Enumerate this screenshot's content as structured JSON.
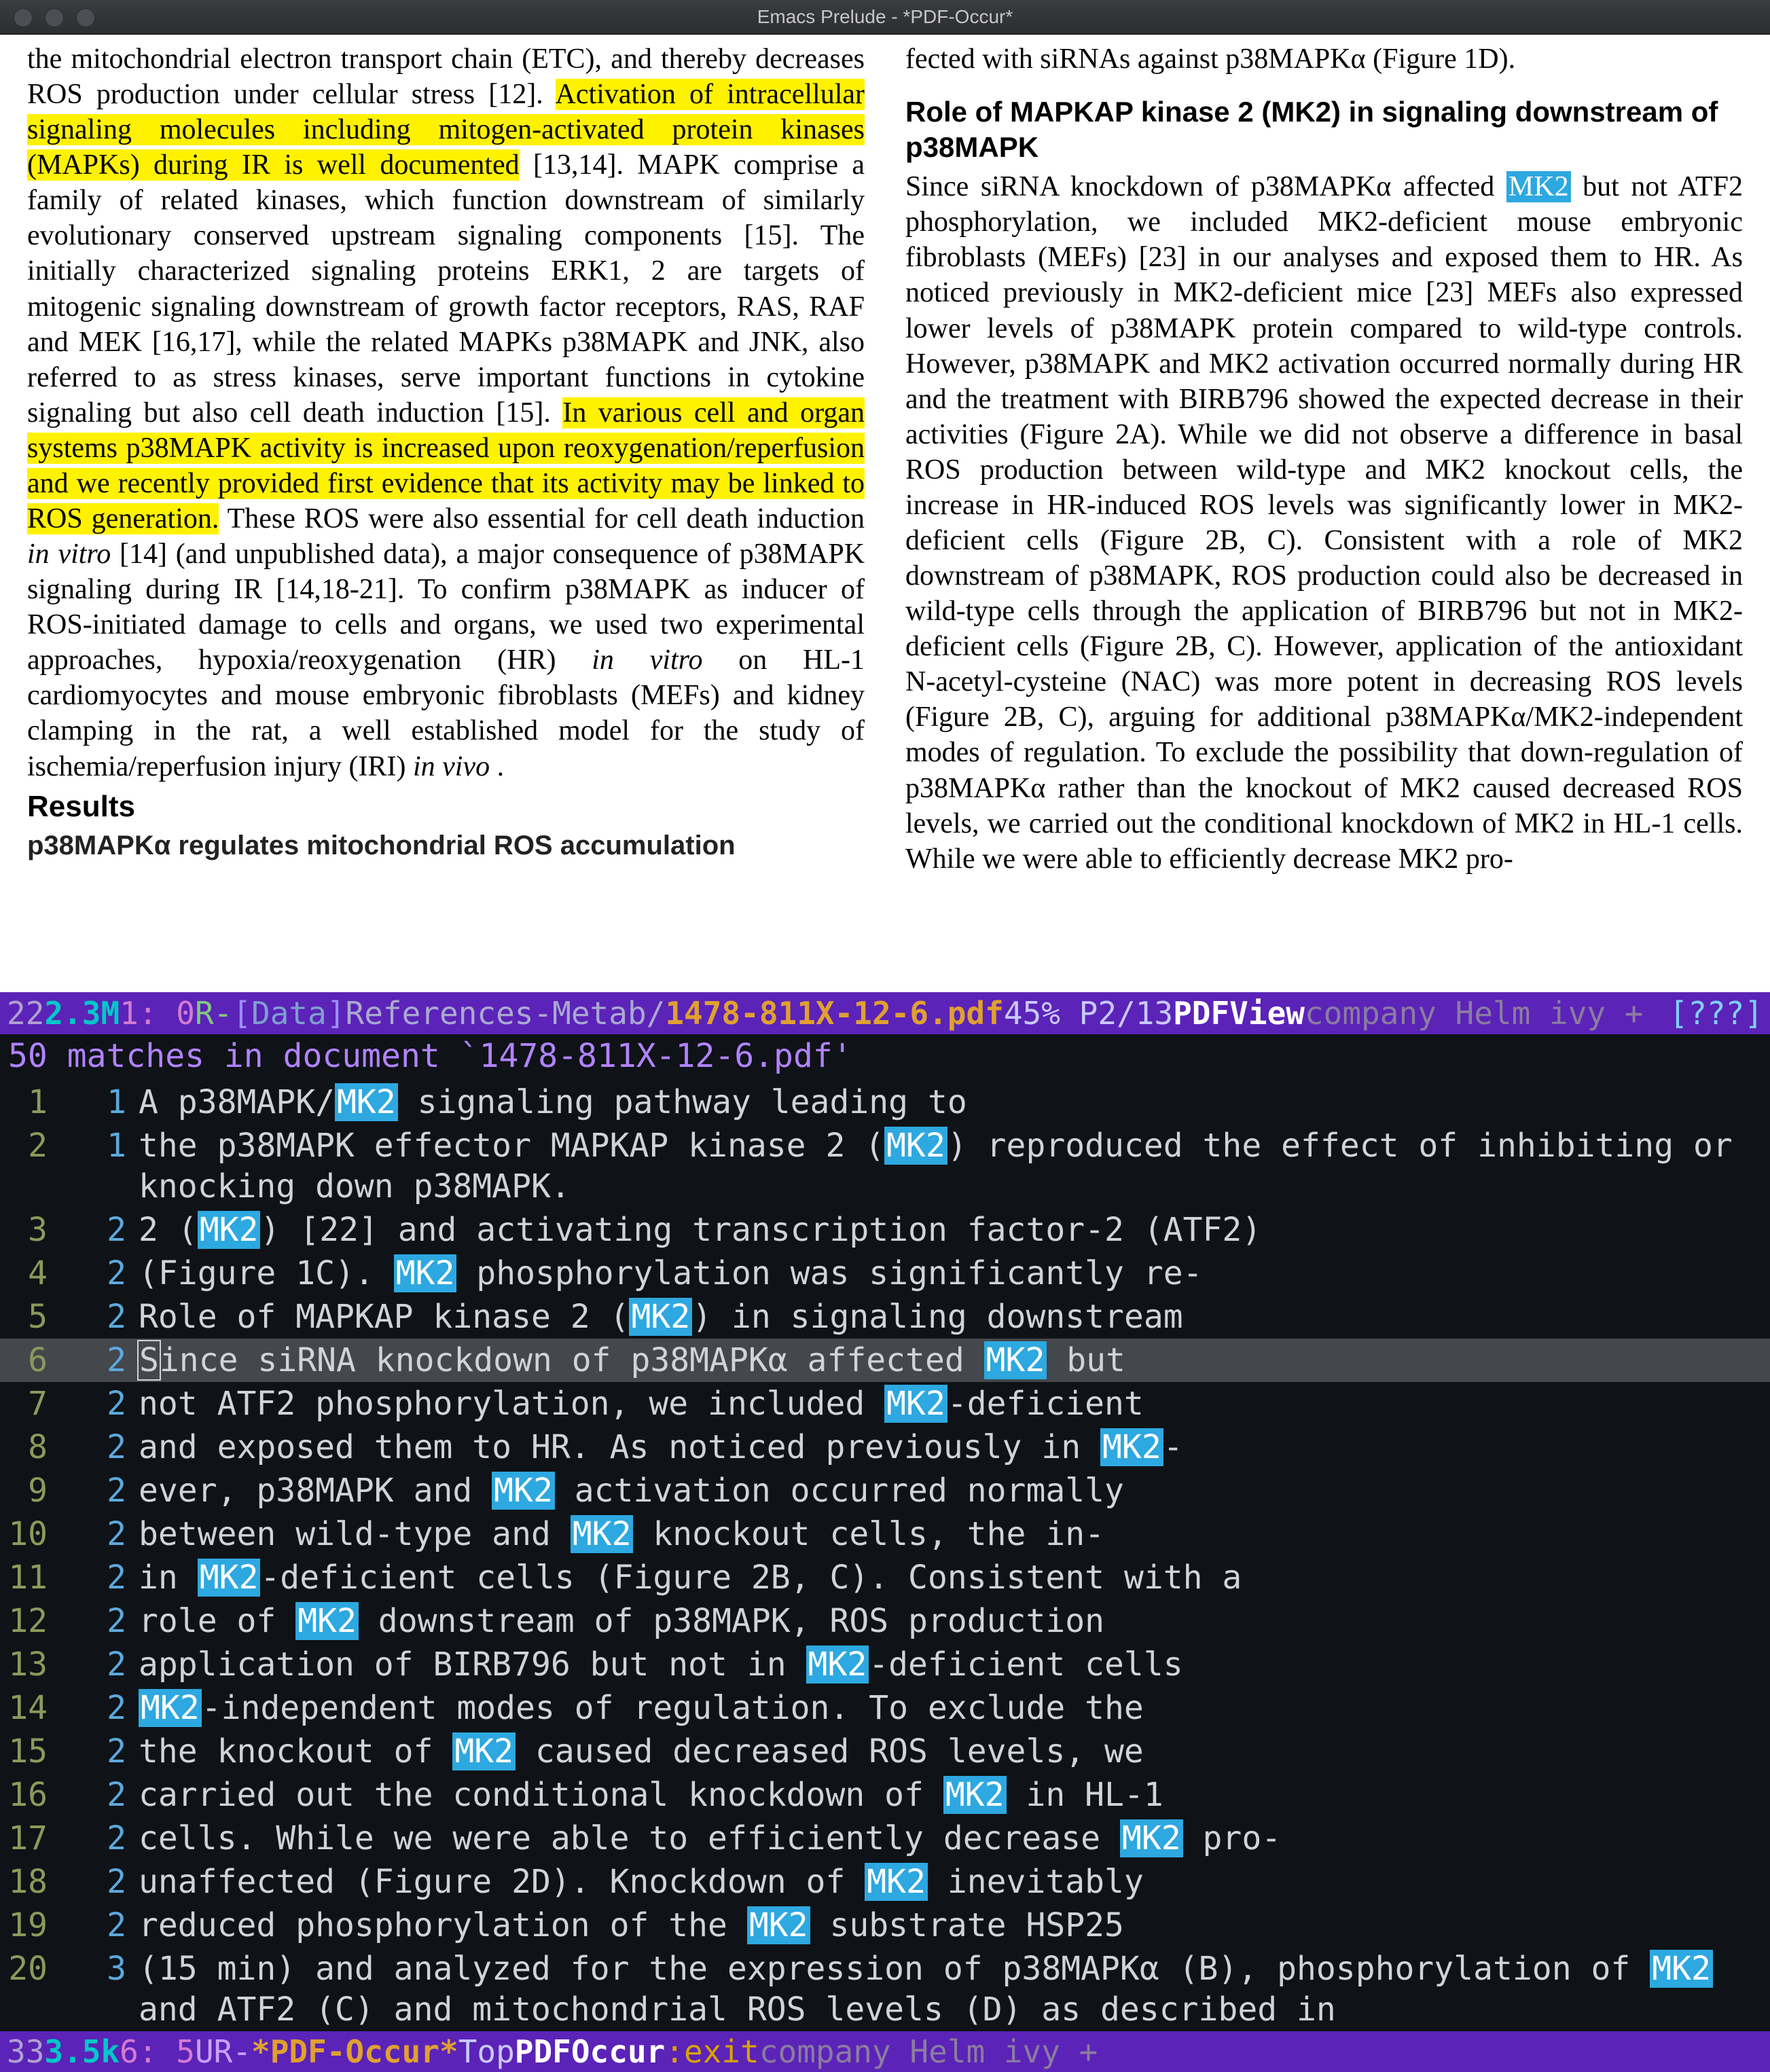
{
  "title": "Emacs Prelude - *PDF-Occur*",
  "pdf": {
    "column_left": {
      "before_hl1": "the mitochondrial electron transport chain (ETC), and thereby decreases ROS production under cellular stress [12]. ",
      "hl1": "Activation of intracellular signaling molecules including mitogen-activated protein kinases (MAPKs) during IR is well documented",
      "after_hl1_part1": " [13,14]. MAPK comprise a family of related kinases, which function downstream of similarly evolutionary conserved upstream signaling components [15]. The initially characterized signaling proteins ERK1, 2 are targets of mitogenic signaling downstream of growth factor receptors, RAS, RAF and MEK [16,17], while the related MAPKs p38MAPK and JNK, also referred to as stress kinases, serve important functions in cytokine signaling but also cell death induction [15]. ",
      "hl2": "In various cell and organ systems p38MAPK activity is increased upon reoxygenation/reperfusion and we recently provided first evidence that its activity may be linked to ROS generation.",
      "after_hl2_a": " These ROS were also essential for cell death induction ",
      "invitro1": "in vitro",
      "after_hl2_b": " [14] (and unpublished data), a major consequence of p38MAPK signaling during IR [14,18-21]. To confirm p38MAPK as inducer of ROS-initiated damage to cells and organs, we used two experimental approaches, hypoxia/reoxygenation (HR) ",
      "invitro2": "in vitro",
      "after_hl2_c": " on HL-1 cardiomyocytes and mouse embryonic fibroblasts (MEFs) and kidney clamping in the rat, a well established model for the study of ischemia/reperfusion injury (IRI) ",
      "invivo": "in vivo",
      "after_hl2_d": ".",
      "results": "Results",
      "sub": "p38MAPKα regulates mitochondrial ROS accumulation"
    },
    "column_right": {
      "top": "fected with siRNAs against p38MAPKα (Figure 1D).",
      "heading": "Role of MAPKAP kinase 2 (MK2) in signaling downstream of p38MAPK",
      "body_before_mk2": "Since siRNA knockdown of p38MAPKα affected ",
      "mk2": "MK2",
      "body_after_mk2": " but not ATF2 phosphorylation, we included MK2-deficient mouse embryonic fibroblasts (MEFs) [23] in our analyses and exposed them to HR. As noticed previously in MK2-deficient mice [23] MEFs also expressed lower levels of p38MAPK protein compared to wild-type controls. However, p38MAPK and MK2 activation occurred normally during HR and the treatment with BIRB796 showed the expected decrease in their activities (Figure 2A). While we did not observe a difference in basal ROS production between wild-type and MK2 knockout cells, the increase in HR-induced ROS levels was significantly lower in MK2-deficient cells (Figure 2B, C). Consistent with a role of MK2 downstream of p38MAPK, ROS production could also be decreased in wild-type cells through the application of BIRB796 but not in MK2-deficient cells (Figure 2B, C). However, application of the antioxidant N-acetyl-cysteine (NAC) was more potent in decreasing ROS levels (Figure 2B, C), arguing for additional p38MAPKα/MK2-independent modes of regulation. To exclude the possibility that down-regulation of p38MAPKα rather than the knockout of MK2 caused decreased ROS levels, we carried out the conditional knockdown of MK2 in HL-1 cells. While we were able to efficiently decrease MK2 pro-"
    }
  },
  "modeline1": {
    "prefix": "22",
    "size": "2.3M",
    "pos": "   1: 0 ",
    "state": "R-",
    "lbr": "[",
    "branch": "Data",
    "rbr": "]",
    "dir": "References-Metab/",
    "file": "1478-811X-12-6.pdf",
    "pct": " 45% P2/13 ",
    "mode": "PDFView",
    "minor": " company Helm ivy +",
    "right": "[???]"
  },
  "occur_header": "50 matches in document `1478-811X-12-6.pdf'",
  "occur": [
    {
      "ln": "1",
      "pg": "1",
      "segments": [
        {
          "t": "A p38MAPK/"
        },
        {
          "t": "MK2",
          "hl": true
        },
        {
          "t": " signaling pathway leading to"
        }
      ]
    },
    {
      "ln": "2",
      "pg": "1",
      "segments": [
        {
          "t": "the p38MAPK effector MAPKAP kinase 2 ("
        },
        {
          "t": "MK2",
          "hl": true
        },
        {
          "t": ") reproduced the effect of inhibiting or knocking down p38MAPK."
        }
      ]
    },
    {
      "ln": "3",
      "pg": "2",
      "segments": [
        {
          "t": "2 ("
        },
        {
          "t": "MK2",
          "hl": true
        },
        {
          "t": ") [22] and activating transcription factor-2 (ATF2)"
        }
      ]
    },
    {
      "ln": "4",
      "pg": "2",
      "segments": [
        {
          "t": "(Figure 1C). "
        },
        {
          "t": "MK2",
          "hl": true
        },
        {
          "t": " phosphorylation was significantly re-"
        }
      ]
    },
    {
      "ln": "5",
      "pg": "2",
      "segments": [
        {
          "t": "Role of MAPKAP kinase 2 ("
        },
        {
          "t": "MK2",
          "hl": true
        },
        {
          "t": ") in signaling downstream"
        }
      ]
    },
    {
      "ln": "6",
      "pg": "2",
      "selected": true,
      "cursor": true,
      "segments": [
        {
          "t": "Since siRNA knockdown of p38MAPKα affected "
        },
        {
          "t": "MK2",
          "hl": true
        },
        {
          "t": " but"
        }
      ]
    },
    {
      "ln": "7",
      "pg": "2",
      "segments": [
        {
          "t": "not ATF2 phosphorylation, we included "
        },
        {
          "t": "MK2",
          "hl": true
        },
        {
          "t": "-deficient"
        }
      ]
    },
    {
      "ln": "8",
      "pg": "2",
      "segments": [
        {
          "t": "and exposed them to HR. As noticed previously in "
        },
        {
          "t": "MK2",
          "hl": true
        },
        {
          "t": "-"
        }
      ]
    },
    {
      "ln": "9",
      "pg": "2",
      "segments": [
        {
          "t": "ever, p38MAPK and "
        },
        {
          "t": "MK2",
          "hl": true
        },
        {
          "t": " activation occurred normally"
        }
      ]
    },
    {
      "ln": "10",
      "pg": "2",
      "segments": [
        {
          "t": "between wild-type and "
        },
        {
          "t": "MK2",
          "hl": true
        },
        {
          "t": " knockout cells, the in-"
        }
      ]
    },
    {
      "ln": "11",
      "pg": "2",
      "segments": [
        {
          "t": "in "
        },
        {
          "t": "MK2",
          "hl": true
        },
        {
          "t": "-deficient cells (Figure 2B, C). Consistent with a"
        }
      ]
    },
    {
      "ln": "12",
      "pg": "2",
      "segments": [
        {
          "t": "role of "
        },
        {
          "t": "MK2",
          "hl": true
        },
        {
          "t": " downstream of p38MAPK, ROS production"
        }
      ]
    },
    {
      "ln": "13",
      "pg": "2",
      "segments": [
        {
          "t": "application of BIRB796 but not in "
        },
        {
          "t": "MK2",
          "hl": true
        },
        {
          "t": "-deficient cells"
        }
      ]
    },
    {
      "ln": "14",
      "pg": "2",
      "segments": [
        {
          "t": "MK2",
          "hl": true
        },
        {
          "t": "-independent modes of regulation. To exclude the"
        }
      ]
    },
    {
      "ln": "15",
      "pg": "2",
      "segments": [
        {
          "t": "the knockout of "
        },
        {
          "t": "MK2",
          "hl": true
        },
        {
          "t": " caused decreased ROS levels, we"
        }
      ]
    },
    {
      "ln": "16",
      "pg": "2",
      "segments": [
        {
          "t": "carried out the conditional knockdown of "
        },
        {
          "t": "MK2",
          "hl": true
        },
        {
          "t": " in HL-1"
        }
      ]
    },
    {
      "ln": "17",
      "pg": "2",
      "segments": [
        {
          "t": "cells. While we were able to efficiently decrease "
        },
        {
          "t": "MK2",
          "hl": true
        },
        {
          "t": " pro-"
        }
      ]
    },
    {
      "ln": "18",
      "pg": "2",
      "segments": [
        {
          "t": "unaffected (Figure 2D). Knockdown of "
        },
        {
          "t": "MK2",
          "hl": true
        },
        {
          "t": " inevitably"
        }
      ]
    },
    {
      "ln": "19",
      "pg": "2",
      "segments": [
        {
          "t": "reduced phosphorylation of the "
        },
        {
          "t": "MK2",
          "hl": true
        },
        {
          "t": " substrate HSP25"
        }
      ]
    },
    {
      "ln": "20",
      "pg": "3",
      "segments": [
        {
          "t": "(15 min) and analyzed for the expression of p38MAPKα (B), phosphorylation of "
        },
        {
          "t": "MK2",
          "hl": true
        },
        {
          "t": " and ATF2 (C) and mitochondrial ROS levels (D) as described in"
        }
      ]
    }
  ],
  "modeline2": {
    "prefix": "33",
    "size": "3.5k",
    "pos": "  6: 5 ",
    "state": "UR-",
    "file": "*PDF-Occur*",
    "mid": "                                                Top ",
    "mode": "PDFOccur",
    "exit": ":exit",
    "minor": " company Helm ivy +"
  }
}
